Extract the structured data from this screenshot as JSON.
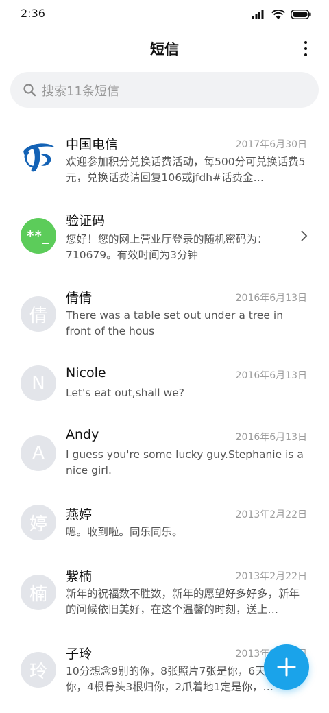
{
  "status_bar": {
    "time": "2:36"
  },
  "header": {
    "title": "短信"
  },
  "search": {
    "placeholder": "搜索11条短信"
  },
  "conversations": [
    {
      "name": "中国电信",
      "date": "2017年6月30日",
      "preview": "欢迎参加积分兑换话费活动，每500分可兑换话费5元，兑换话费请回复106或jfdh#话费金…",
      "avatar_icon": "china-telecom-logo-icon"
    },
    {
      "name": "验证码",
      "date": "",
      "preview": "您好！您的网上营业厅登录的随机密码为：710679。有效时间为3分钟",
      "avatar_text": "**_"
    },
    {
      "name": "倩倩",
      "date": "2016年6月13日",
      "preview": "There was a table set out under a tree in front of the hous",
      "avatar_text": "倩"
    },
    {
      "name": "Nicole",
      "date": "2016年6月13日",
      "preview": "Let's eat out,shall we?",
      "avatar_text": "N"
    },
    {
      "name": "Andy",
      "date": "2016年6月13日",
      "preview": "I guess you're some lucky guy.Stephanie is a nice girl.",
      "avatar_text": "A"
    },
    {
      "name": "燕婷",
      "date": "2013年2月22日",
      "preview": "嗯。收到啦。同乐同乐。",
      "avatar_text": "婷"
    },
    {
      "name": "紫楠",
      "date": "2013年2月22日",
      "preview": "新年的祝福数不胜数，新年的愿望好多好多，新年的问候依旧美好，在这个温馨的时刻，送上…",
      "avatar_text": "楠"
    },
    {
      "name": "子玲",
      "date": "2013年2月22日",
      "preview": "10分想念9别的你，8张照片7张是你，6天只像你，4根骨头3根归你，2爪着地1定是你，…",
      "avatar_text": "玲"
    }
  ],
  "colors": {
    "accent": "#1aa3ea",
    "verify_green": "#5ccc5a",
    "avatar_gray": "#e3e5ea",
    "telecom_blue": "#1362b5"
  }
}
